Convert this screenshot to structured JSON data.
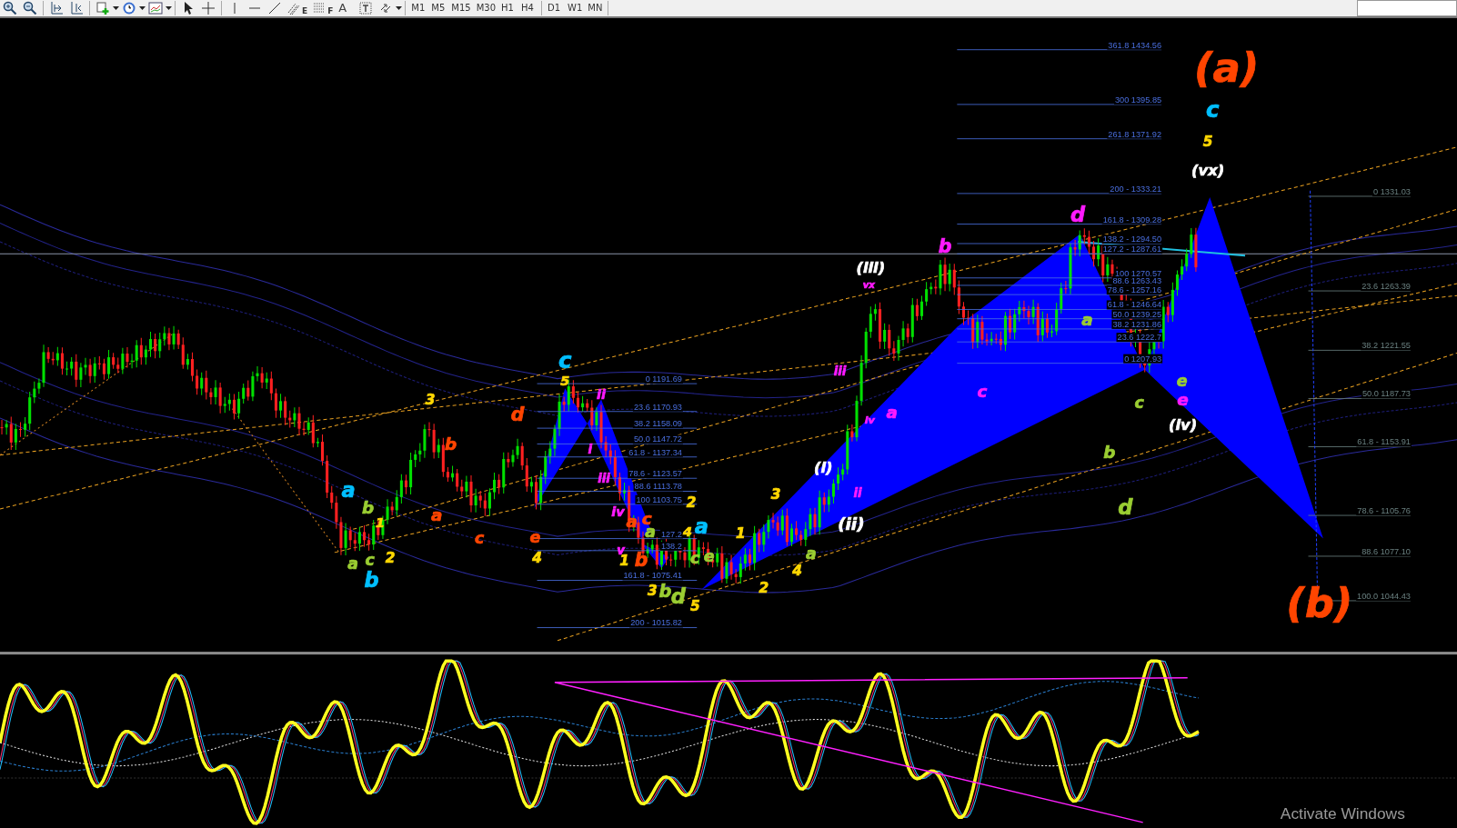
{
  "toolbar": {
    "text_tool": "A",
    "fib_tools": [
      "E",
      "F"
    ],
    "timeframes": [
      "M1",
      "M5",
      "M15",
      "M30",
      "H1",
      "H4",
      "D1",
      "W1",
      "MN"
    ]
  },
  "fib_groups": [
    {
      "levels": [
        "0 1191.69",
        "23.6 1170.93",
        "38.2 1158.09",
        "50.0 1147.72",
        "61.8 - 1137.34",
        "78.6 - 1123.57",
        "88.6 1113.78",
        "100 1103.75",
        "127.2",
        "138.2",
        "161.8 - 1075.41",
        "200 - 1015.82"
      ]
    },
    {
      "levels": [
        "361.8 1434.56",
        "300 1395.85",
        "261.8 1371.92",
        "200 - 1333.21",
        "161.8 - 1309.28",
        "138.2 - 1294.50",
        "127.2 - 1287.61",
        "100 1270.57",
        "88.6 1263.43",
        "78.6 - 1257.16",
        "61.8 - 1246.64",
        "50.0 1239.25",
        "38.2 1231.86",
        "23.6 1222.7",
        "0 1207.93"
      ]
    },
    {
      "levels": [
        "0 1331.03",
        "23.6 1263.39",
        "38.2 1221.55",
        "50.0 1187.73",
        "61.8 - 1153.91",
        "78.6 - 1105.76",
        "88.6 1077.10",
        "100.0 1044.43"
      ]
    }
  ],
  "wave_labels": [
    {
      "text": "(a)",
      "color": "#ff4500"
    },
    {
      "text": "(b)",
      "color": "#ff4500"
    },
    {
      "text": "c",
      "color": "#00bfff"
    },
    {
      "text": "5",
      "color": "#ffd700"
    },
    {
      "text": "(vx)",
      "color": "#ffffff"
    },
    {
      "text": "(iii)",
      "color": "#ffffff"
    },
    {
      "text": "vx",
      "color": "#ff1aff"
    },
    {
      "text": "b",
      "color": "#ff1aff"
    },
    {
      "text": "d",
      "color": "#ff1aff"
    },
    {
      "text": "a",
      "color": "#9acd32"
    },
    {
      "text": "c",
      "color": "#ff1aff"
    },
    {
      "text": "iii",
      "color": "#ff1aff"
    },
    {
      "text": "a",
      "color": "#ff1aff"
    },
    {
      "text": "iv",
      "color": "#ff1aff"
    },
    {
      "text": "(i)",
      "color": "#ffffff"
    },
    {
      "text": "ii",
      "color": "#ff1aff"
    },
    {
      "text": "(ii)",
      "color": "#ffffff"
    },
    {
      "text": "3",
      "color": "#ffd700"
    },
    {
      "text": "a",
      "color": "#9acd32"
    },
    {
      "text": "4",
      "color": "#ffd700"
    },
    {
      "text": "2",
      "color": "#ffd700"
    },
    {
      "text": "4",
      "color": "#ffd700"
    },
    {
      "text": "a",
      "color": "#00bfff"
    },
    {
      "text": "1",
      "color": "#ffd700"
    },
    {
      "text": "c",
      "color": "#9acd32"
    },
    {
      "text": "e",
      "color": "#9acd32"
    },
    {
      "text": "d",
      "color": "#9acd32"
    },
    {
      "text": "5",
      "color": "#ffd700"
    },
    {
      "text": "3",
      "color": "#ffd700"
    },
    {
      "text": "b",
      "color": "#9acd32"
    },
    {
      "text": "a",
      "color": "#00bfff"
    },
    {
      "text": "b",
      "color": "#9acd32"
    },
    {
      "text": "1",
      "color": "#ffd700"
    },
    {
      "text": "a",
      "color": "#9acd32"
    },
    {
      "text": "c",
      "color": "#9acd32"
    },
    {
      "text": "2",
      "color": "#ffd700"
    },
    {
      "text": "b",
      "color": "#00bfff"
    },
    {
      "text": "3",
      "color": "#ffd700"
    },
    {
      "text": "b",
      "color": "#ff4500"
    },
    {
      "text": "a",
      "color": "#ff4500"
    },
    {
      "text": "c",
      "color": "#ff4500"
    },
    {
      "text": "d",
      "color": "#ff4500"
    },
    {
      "text": "e",
      "color": "#ff4500"
    },
    {
      "text": "4",
      "color": "#ffd700"
    },
    {
      "text": "c",
      "color": "#00bfff"
    },
    {
      "text": "5",
      "color": "#ffd700"
    },
    {
      "text": "ii",
      "color": "#ff1aff"
    },
    {
      "text": "i",
      "color": "#ff1aff"
    },
    {
      "text": "iii",
      "color": "#ff1aff"
    },
    {
      "text": "iv",
      "color": "#ff1aff"
    },
    {
      "text": "2",
      "color": "#ffd700"
    },
    {
      "text": "a",
      "color": "#ff4500"
    },
    {
      "text": "c",
      "color": "#ff4500"
    },
    {
      "text": "a",
      "color": "#9acd32"
    },
    {
      "text": "v",
      "color": "#ff1aff"
    },
    {
      "text": "1",
      "color": "#ffd700"
    },
    {
      "text": "b",
      "color": "#ff4500"
    },
    {
      "text": "e",
      "color": "#9acd32"
    },
    {
      "text": "c",
      "color": "#9acd32"
    },
    {
      "text": "e",
      "color": "#ff1aff"
    },
    {
      "text": "(iv)",
      "color": "#ffffff"
    },
    {
      "text": "b",
      "color": "#9acd32"
    },
    {
      "text": "d",
      "color": "#9acd32"
    }
  ],
  "os_notice": "Activate Windows"
}
